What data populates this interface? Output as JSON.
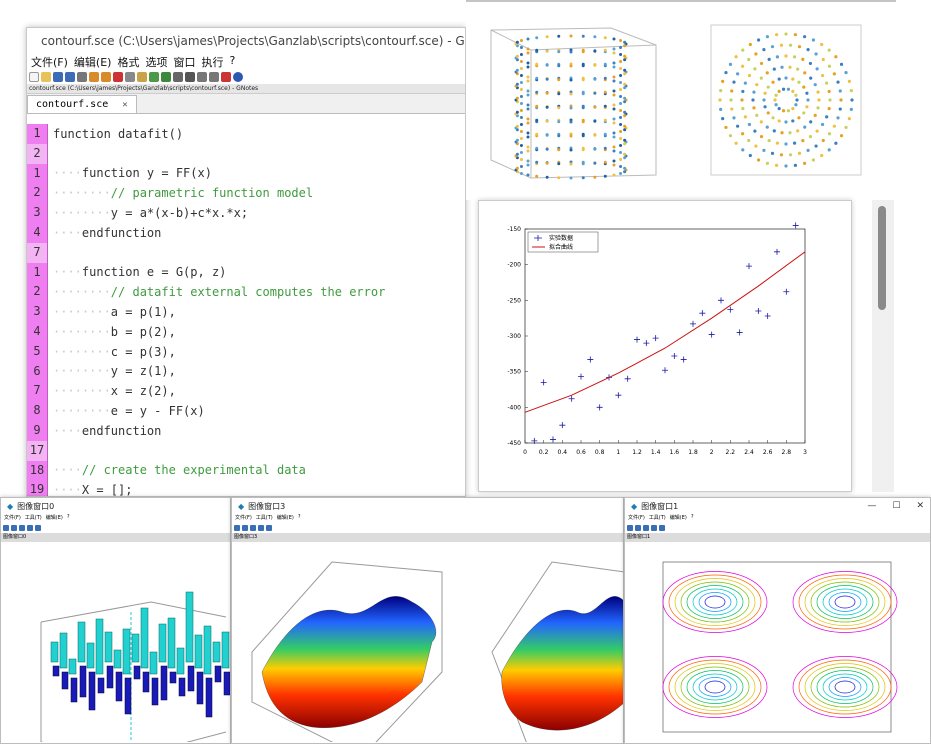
{
  "editor": {
    "title": "contourf.sce (C:\\Users\\james\\Projects\\Ganzlab\\scripts\\contourf.sce) - GNotes",
    "menu": [
      "文件(F)",
      "编辑(E)",
      "格式",
      "选项",
      "窗口",
      "执行",
      "?"
    ],
    "path": "contourf.sce (C:\\Users\\james\\Projects\\Ganzlab\\scripts\\contourf.sce) - GNotes",
    "tab_label": "contourf.sce",
    "tab_close": "✕",
    "gutter": [
      "1",
      "2",
      "1",
      "2",
      "3",
      "4",
      "7",
      "1",
      "2",
      "3",
      "4",
      "5",
      "6",
      "7",
      "8",
      "9",
      "17",
      "18",
      "19"
    ],
    "code_lines": [
      "function datafit()",
      "",
      "····function y = FF(x)",
      "········// parametric function model",
      "········y = a*(x-b)+c*x.*x;",
      "····endfunction",
      "",
      "····function e = G(p, z)",
      "········// datafit external computes the error",
      "········a = p(1),",
      "········b = p(2),",
      "········c = p(3),",
      "········y = z(1),",
      "········x = z(2),",
      "········e = y - FF(x)",
      "····endfunction",
      "",
      "····// create the experimental data",
      "····X = [];"
    ]
  },
  "fit_plot": {
    "legend": [
      "实验数据",
      "拟合曲线"
    ],
    "colors": {
      "data": "#1a1aa8",
      "fit": "#cc1111"
    }
  },
  "chart_data": {
    "type": "scatter",
    "xlim": [
      0,
      3
    ],
    "ylim": [
      -450,
      -150
    ],
    "x_ticks": [
      "0",
      "0.2",
      "0.4",
      "0.6",
      "0.8",
      "1",
      "1.2",
      "1.4",
      "1.6",
      "1.8",
      "2",
      "2.2",
      "2.4",
      "2.6",
      "2.8",
      "3"
    ],
    "y_ticks": [
      "-150",
      "-200",
      "-250",
      "-300",
      "-350",
      "-400",
      "-450"
    ],
    "series": [
      {
        "name": "实验数据",
        "x": [
          0.1,
          0.2,
          0.3,
          0.4,
          0.5,
          0.6,
          0.7,
          0.8,
          0.9,
          1.0,
          1.1,
          1.2,
          1.3,
          1.4,
          1.5,
          1.6,
          1.7,
          1.8,
          1.9,
          2.0,
          2.1,
          2.2,
          2.3,
          2.4,
          2.5,
          2.6,
          2.7,
          2.8,
          2.9
        ],
        "y": [
          -447,
          -365,
          -445,
          -425,
          -388,
          -357,
          -333,
          -400,
          -358,
          -383,
          -360,
          -305,
          -310,
          -303,
          -348,
          -328,
          -333,
          -283,
          -268,
          -298,
          -250,
          -263,
          -295,
          -202,
          -265,
          -272,
          -182,
          -238,
          -145
        ]
      },
      {
        "name": "拟合曲线",
        "x": [
          0,
          0.5,
          1,
          1.5,
          2,
          2.5,
          3
        ],
        "y": [
          -407,
          -383,
          -352,
          -317,
          -275,
          -230,
          -182
        ]
      }
    ]
  },
  "windows": [
    {
      "title": "图像窗口0",
      "menu": [
        "文件(F)",
        "工具(T)",
        "编辑(E)",
        "?"
      ],
      "path": "图像窗口0"
    },
    {
      "title": "图像窗口3",
      "menu": [
        "文件(F)",
        "工具(T)",
        "编辑(E)",
        "?"
      ],
      "path": "图像窗口3"
    },
    {
      "title": "图像窗口1",
      "menu": [
        "文件(F)",
        "工具(T)",
        "编辑(E)",
        "?"
      ],
      "path": "图像窗口1"
    }
  ]
}
